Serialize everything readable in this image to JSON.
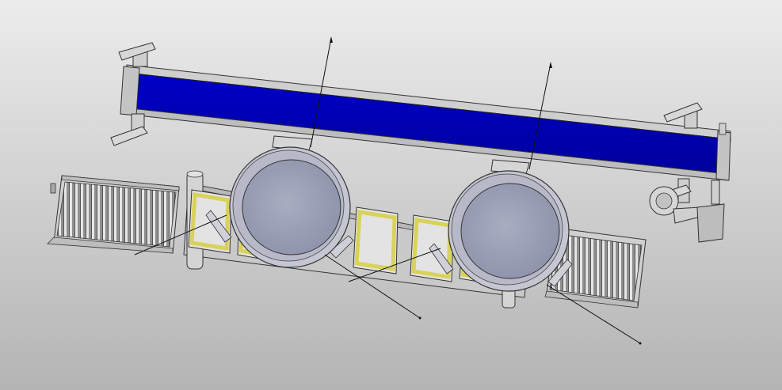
{
  "scene": {
    "description_free": true,
    "colors": {
      "background_top": "#ececec",
      "background_bottom": "#b4b4b4",
      "belt_blue": "#0000b8",
      "frame_grey": "#c8c8c8",
      "drum_face": "#9ea2b8",
      "drum_rim": "#c4c6d2",
      "tray_yellow": "#d9d25a",
      "outline": "#2a2a2a"
    },
    "parts": {
      "drums": 2,
      "trays": 5,
      "leader_lines": 6,
      "roller_conveyors": 2
    }
  }
}
